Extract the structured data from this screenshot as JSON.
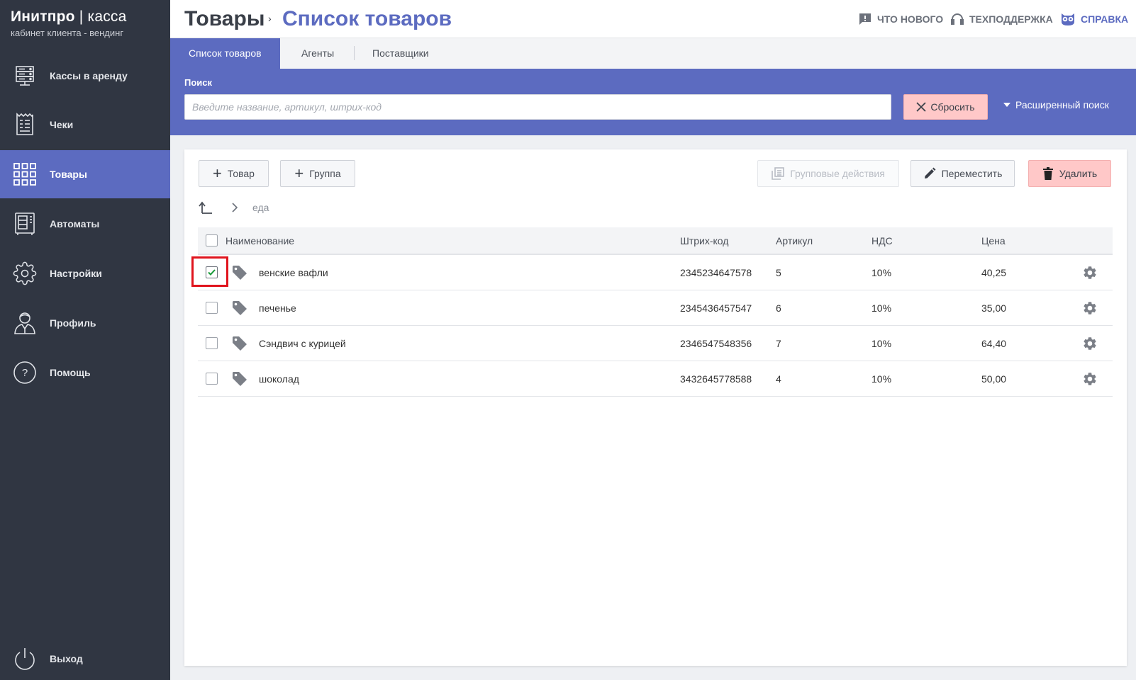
{
  "brand": {
    "name": "Инитпро",
    "separator": "|",
    "product": "касса",
    "subtitle": "кабинет клиента - вендинг"
  },
  "sidebar": {
    "items": [
      {
        "label": "Кассы в аренду",
        "icon": "server-rack-icon"
      },
      {
        "label": "Чеки",
        "icon": "receipt-icon"
      },
      {
        "label": "Товары",
        "icon": "grid-icon",
        "active": true
      },
      {
        "label": "Автоматы",
        "icon": "vending-machine-icon"
      },
      {
        "label": "Настройки",
        "icon": "gear-icon"
      },
      {
        "label": "Профиль",
        "icon": "user-icon"
      },
      {
        "label": "Помощь",
        "icon": "question-circle-icon"
      }
    ],
    "logout": {
      "label": "Выход",
      "icon": "power-icon"
    }
  },
  "header": {
    "breadcrumb_root": "Товары",
    "breadcrumb_sep": "›",
    "breadcrumb_current": "Список товаров",
    "links": {
      "whats_new": "ЧТО НОВОГО",
      "support": "ТЕХПОДДЕРЖКА",
      "help": "СПРАВКА"
    }
  },
  "tabs": [
    {
      "label": "Список товаров",
      "active": true
    },
    {
      "label": "Агенты"
    },
    {
      "label": "Поставщики"
    }
  ],
  "search": {
    "label": "Поиск",
    "value": "",
    "placeholder": "Введите название, артикул, штрих-код",
    "reset_label": "Сбросить",
    "advanced_label": "Расширенный поиск"
  },
  "toolbar": {
    "add_item": "Товар",
    "add_group": "Группа",
    "group_actions": "Групповые действия",
    "move": "Переместить",
    "delete": "Удалить"
  },
  "path": {
    "folder": "еда"
  },
  "table": {
    "columns": {
      "name": "Наименование",
      "barcode": "Штрих-код",
      "article": "Артикул",
      "vat": "НДС",
      "price": "Цена"
    },
    "rows": [
      {
        "checked": true,
        "name": "венские вафли",
        "barcode": "2345234647578",
        "article": "5",
        "vat": "10%",
        "price": "40,25"
      },
      {
        "checked": false,
        "name": "печенье",
        "barcode": "2345436457547",
        "article": "6",
        "vat": "10%",
        "price": "35,00"
      },
      {
        "checked": false,
        "name": "Сэндвич с курицей",
        "barcode": "2346547548356",
        "article": "7",
        "vat": "10%",
        "price": "64,40"
      },
      {
        "checked": false,
        "name": "шоколад",
        "barcode": "3432645778588",
        "article": "4",
        "vat": "10%",
        "price": "50,00"
      }
    ]
  },
  "colors": {
    "accent": "#5c6bc0",
    "sidebar": "#303642",
    "danger_bg": "#ffc8c8",
    "highlight": "#e0141d"
  }
}
